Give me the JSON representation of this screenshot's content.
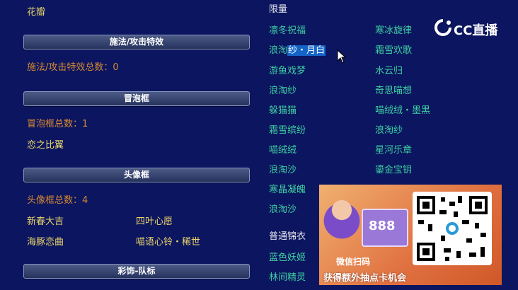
{
  "left": {
    "top_item": "花瓣",
    "sections": {
      "cast_effect": {
        "title": "施法/攻击特效",
        "count": "施法/攻击特效总数：0"
      },
      "bubble": {
        "title": "冒泡框",
        "count": "冒泡框总数：1",
        "items": [
          "恋之比翼"
        ]
      },
      "avatar_frame": {
        "title": "头像框",
        "count": "头像框总数：4",
        "items": [
          "新春大吉",
          "四叶心愿",
          "海豚恋曲",
          "喵语心铃・稀世"
        ]
      },
      "decoration_team": {
        "title": "彩饰-队标"
      }
    }
  },
  "right": {
    "limited_header": "限量",
    "col1": [
      "凛冬祝福",
      "浪淘纱・月白",
      "游鱼戏梦",
      "浪淘纱",
      "躲猫猫",
      "霜雪缤纷",
      "喵绒绒",
      "浪淘沙",
      "寒晶凝魄",
      "浪淘沙"
    ],
    "col2": [
      "寒冰旋律",
      "霜雪欢歌",
      "水云归",
      "奇思喵想",
      "喵绒绒・墨黑",
      "浪淘纱",
      "星河乐章",
      "鎏金宝钥"
    ],
    "normal_header": "普通锦衣",
    "normal_items": [
      "蓝色妖姬",
      "林间精灵"
    ],
    "selected_item": "浪淘纱・月白",
    "selected_prefix": "浪淘",
    "selected_highlight": "纱・月白"
  },
  "overlay": {
    "logo_text": "CC直播",
    "ad_card_value": "888",
    "ad_wechat_text": "微信扫码",
    "ad_prize_text": "获得额外抽点卡机会"
  },
  "colors": {
    "background": "#0b1560",
    "orange_text": "#d98a30",
    "yellow_text": "#ecd66a",
    "green_text": "#3fd0a0",
    "selection": "#1464c8"
  }
}
